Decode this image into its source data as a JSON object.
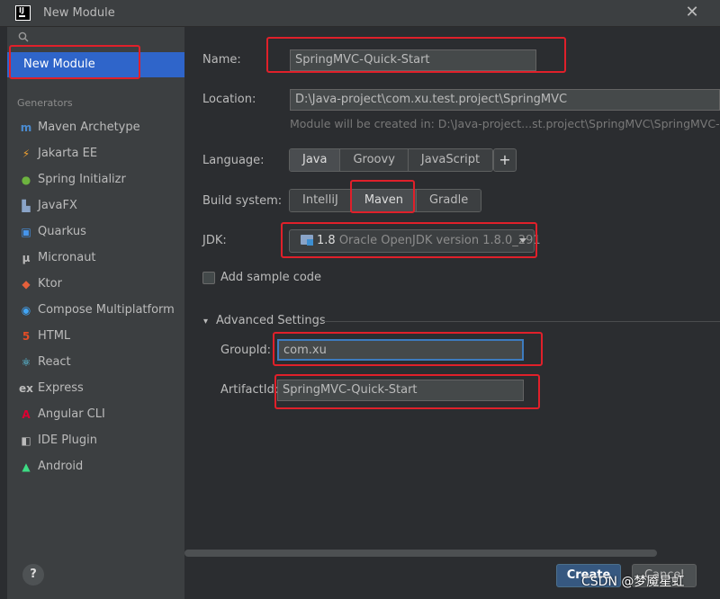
{
  "window": {
    "title": "New Module",
    "close_glyph": "✕"
  },
  "sidebar": {
    "selected_label": "New Module",
    "generators_header": "Generators",
    "items": [
      {
        "label": "Maven Archetype",
        "icon": "m-icon",
        "glyph": "m",
        "color": "#4a8bd0"
      },
      {
        "label": "Jakarta EE",
        "icon": "jakarta-icon",
        "glyph": "⚡",
        "color": "#f0a030"
      },
      {
        "label": "Spring Initializr",
        "icon": "spring-icon",
        "glyph": "●",
        "color": "#6db33f"
      },
      {
        "label": "JavaFX",
        "icon": "javafx-icon",
        "glyph": "▙",
        "color": "#8aa4c8"
      },
      {
        "label": "Quarkus",
        "icon": "quarkus-icon",
        "glyph": "▣",
        "color": "#4695eb"
      },
      {
        "label": "Micronaut",
        "icon": "micronaut-icon",
        "glyph": "μ",
        "color": "#bbbbbb"
      },
      {
        "label": "Ktor",
        "icon": "ktor-icon",
        "glyph": "◆",
        "color": "#e5603b"
      },
      {
        "label": "Compose Multiplatform",
        "icon": "compose-icon",
        "glyph": "◉",
        "color": "#42a5f5"
      },
      {
        "label": "HTML",
        "icon": "html-icon",
        "glyph": "5",
        "color": "#e44d26"
      },
      {
        "label": "React",
        "icon": "react-icon",
        "glyph": "⚛",
        "color": "#61dafb"
      },
      {
        "label": "Express",
        "icon": "express-icon",
        "glyph": "ex",
        "color": "#bbbbbb"
      },
      {
        "label": "Angular CLI",
        "icon": "angular-icon",
        "glyph": "A",
        "color": "#dd0031"
      },
      {
        "label": "IDE Plugin",
        "icon": "ide-plugin-icon",
        "glyph": "◧",
        "color": "#bbbbbb"
      },
      {
        "label": "Android",
        "icon": "android-icon",
        "glyph": "▲",
        "color": "#3ddc84"
      }
    ],
    "help_label": "?"
  },
  "form": {
    "name_label": "Name:",
    "name_value": "SpringMVC-Quick-Start",
    "location_label": "Location:",
    "location_value": "D:\\Java-project\\com.xu.test.project\\SpringMVC",
    "location_hint": "Module will be created in: D:\\Java-project...st.project\\SpringMVC\\SpringMVC-Qu",
    "language_label": "Language:",
    "languages": [
      "Java",
      "Groovy",
      "JavaScript"
    ],
    "add_language": "+",
    "build_label": "Build system:",
    "build_systems": [
      "IntelliJ",
      "Maven",
      "Gradle"
    ],
    "jdk_label": "JDK:",
    "jdk_version": "1.8",
    "jdk_description": "Oracle OpenJDK version 1.8.0_291",
    "sample_code_label": "Add sample code",
    "advanced_label": "Advanced Settings",
    "group_label": "GroupId:",
    "group_value": "com.xu",
    "artifact_label": "ArtifactId:",
    "artifact_value": "SpringMVC-Quick-Start"
  },
  "buttons": {
    "create": "Create",
    "cancel": "Cancel"
  },
  "watermark": "CSDN @梦魇星虹",
  "colors": {
    "accent": "#2f65ca",
    "highlight": "#e0202a"
  }
}
